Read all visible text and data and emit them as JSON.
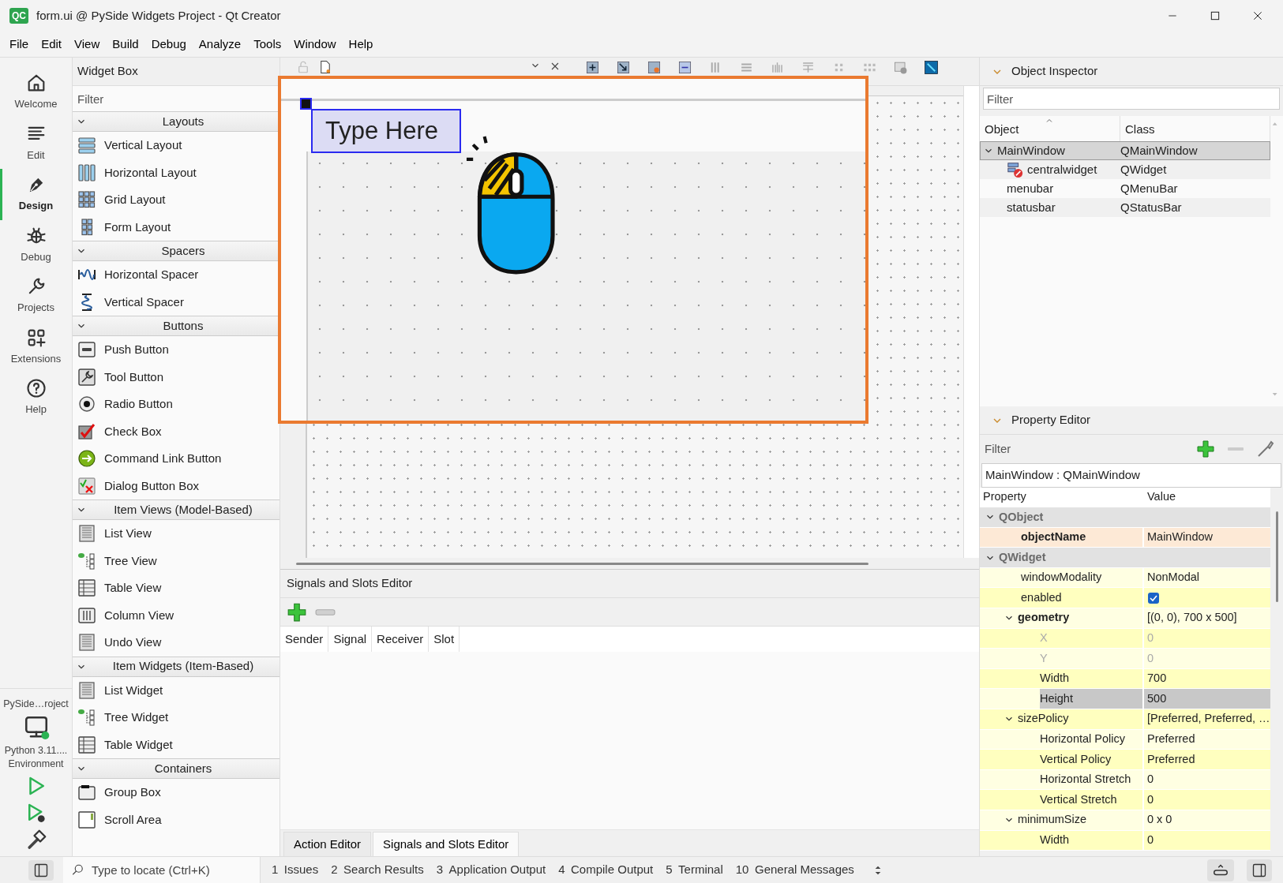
{
  "window": {
    "icon_text": "QC",
    "title": "form.ui @ PySide Widgets Project - Qt Creator"
  },
  "menu": [
    "File",
    "Edit",
    "View",
    "Build",
    "Debug",
    "Analyze",
    "Tools",
    "Window",
    "Help"
  ],
  "modes": [
    {
      "label": "Welcome",
      "kind": "home",
      "selected": false
    },
    {
      "label": "Edit",
      "kind": "edit",
      "selected": false
    },
    {
      "label": "Design",
      "kind": "design",
      "selected": true
    },
    {
      "label": "Debug",
      "kind": "debug",
      "selected": false
    },
    {
      "label": "Projects",
      "kind": "projects",
      "selected": false
    },
    {
      "label": "Extensions",
      "kind": "extensions",
      "selected": false
    },
    {
      "label": "Help",
      "kind": "help",
      "selected": false
    }
  ],
  "kit": {
    "project": "PySide…roject",
    "lines": [
      "Python 3.11....",
      "Environment"
    ]
  },
  "widget_box": {
    "title": "Widget Box",
    "filter_placeholder": "Filter",
    "categories": [
      {
        "name": "Layouts",
        "expanded": true,
        "items": [
          {
            "label": "Vertical Layout",
            "kind": "vlayout"
          },
          {
            "label": "Horizontal Layout",
            "kind": "hlayout"
          },
          {
            "label": "Grid Layout",
            "kind": "grid"
          },
          {
            "label": "Form Layout",
            "kind": "form"
          }
        ]
      },
      {
        "name": "Spacers",
        "expanded": true,
        "items": [
          {
            "label": "Horizontal Spacer",
            "kind": "hspacer"
          },
          {
            "label": "Vertical Spacer",
            "kind": "vspacer"
          }
        ]
      },
      {
        "name": "Buttons",
        "expanded": true,
        "items": [
          {
            "label": "Push Button",
            "kind": "push"
          },
          {
            "label": "Tool Button",
            "kind": "tool"
          },
          {
            "label": "Radio Button",
            "kind": "radio"
          },
          {
            "label": "Check Box",
            "kind": "check"
          },
          {
            "label": "Command Link Button",
            "kind": "link"
          },
          {
            "label": "Dialog Button Box",
            "kind": "dialog"
          }
        ]
      },
      {
        "name": "Item Views (Model-Based)",
        "expanded": true,
        "items": [
          {
            "label": "List View",
            "kind": "list"
          },
          {
            "label": "Tree View",
            "kind": "tree"
          },
          {
            "label": "Table View",
            "kind": "table"
          },
          {
            "label": "Column View",
            "kind": "columns"
          },
          {
            "label": "Undo View",
            "kind": "list"
          }
        ]
      },
      {
        "name": "Item Widgets (Item-Based)",
        "expanded": true,
        "items": [
          {
            "label": "List Widget",
            "kind": "list"
          },
          {
            "label": "Tree Widget",
            "kind": "tree"
          },
          {
            "label": "Table Widget",
            "kind": "table"
          }
        ]
      },
      {
        "name": "Containers",
        "expanded": true,
        "items": [
          {
            "label": "Group Box",
            "kind": "group"
          },
          {
            "label": "Scroll Area",
            "kind": "scroll"
          }
        ]
      }
    ]
  },
  "form": {
    "menu_placeholder": "Type Here"
  },
  "signals_editor": {
    "title": "Signals and Slots Editor",
    "columns": [
      "Sender",
      "Signal",
      "Receiver",
      "Slot"
    ],
    "tabs": [
      {
        "label": "Action Editor",
        "selected": false
      },
      {
        "label": "Signals and Slots Editor",
        "selected": true
      }
    ]
  },
  "object_inspector": {
    "title": "Object Inspector",
    "filter_placeholder": "Filter",
    "columns": [
      "Object",
      "Class"
    ],
    "rows": [
      {
        "object": "MainWindow",
        "class": "QMainWindow",
        "selected": true,
        "expanded": true,
        "children": [
          {
            "object": "centralwidget",
            "class": "QWidget",
            "selected": false,
            "kind": "broken-layout"
          },
          {
            "object": "menubar",
            "class": "QMenuBar",
            "selected": false
          },
          {
            "object": "statusbar",
            "class": "QStatusBar",
            "selected": false
          }
        ]
      }
    ]
  },
  "property_editor": {
    "title": "Property Editor",
    "filter_placeholder": "Filter",
    "object_label": "MainWindow : QMainWindow",
    "columns": [
      "Property",
      "Value"
    ],
    "groups": [
      {
        "name": "QObject",
        "expanded": true,
        "color": "#fde9d6",
        "properties": [
          {
            "name": "objectName",
            "value": "MainWindow",
            "kind": "text",
            "modified": true,
            "disabled": false,
            "selected": false
          }
        ]
      },
      {
        "name": "QWidget",
        "expanded": true,
        "color": "#ffffbf",
        "properties": [
          {
            "name": "windowModality",
            "value": "NonModal",
            "kind": "text",
            "modified": false,
            "disabled": false,
            "selected": false
          },
          {
            "name": "enabled",
            "checked": true,
            "kind": "check",
            "modified": false,
            "disabled": false,
            "selected": false
          },
          {
            "name": "geometry",
            "value": "[(0, 0), 700 x 500]",
            "kind": "text",
            "modified": true,
            "disabled": false,
            "selected": false,
            "expanded": true,
            "children": [
              {
                "name": "X",
                "value": "0",
                "kind": "text",
                "modified": false,
                "disabled": true,
                "selected": false
              },
              {
                "name": "Y",
                "value": "0",
                "kind": "text",
                "modified": false,
                "disabled": true,
                "selected": false
              },
              {
                "name": "Width",
                "value": "700",
                "kind": "text",
                "modified": false,
                "disabled": false,
                "selected": false
              },
              {
                "name": "Height",
                "value": "500",
                "kind": "text",
                "modified": false,
                "disabled": false,
                "selected": true
              }
            ]
          },
          {
            "name": "sizePolicy",
            "value": "[Preferred, Preferred, …",
            "kind": "text",
            "modified": false,
            "disabled": false,
            "selected": false,
            "expanded": true,
            "children": [
              {
                "name": "Horizontal Policy",
                "value": "Preferred",
                "kind": "text",
                "modified": false,
                "disabled": false,
                "selected": false
              },
              {
                "name": "Vertical Policy",
                "value": "Preferred",
                "kind": "text",
                "modified": false,
                "disabled": false,
                "selected": false
              },
              {
                "name": "Horizontal Stretch",
                "value": "0",
                "kind": "text",
                "modified": false,
                "disabled": false,
                "selected": false
              },
              {
                "name": "Vertical Stretch",
                "value": "0",
                "kind": "text",
                "modified": false,
                "disabled": false,
                "selected": false
              }
            ]
          },
          {
            "name": "minimumSize",
            "value": "0 x 0",
            "kind": "text",
            "modified": false,
            "disabled": false,
            "selected": false,
            "expanded": true,
            "children": [
              {
                "name": "Width",
                "value": "0",
                "kind": "text",
                "modified": false,
                "disabled": false,
                "selected": false
              }
            ]
          }
        ]
      }
    ]
  },
  "status_bar": {
    "locator_placeholder": "Type to locate (Ctrl+K)",
    "panes": [
      {
        "number": "1",
        "label": "Issues"
      },
      {
        "number": "2",
        "label": "Search Results"
      },
      {
        "number": "3",
        "label": "Application Output"
      },
      {
        "number": "4",
        "label": "Compile Output"
      },
      {
        "number": "5",
        "label": "Terminal"
      },
      {
        "number": "10",
        "label": "General Messages"
      }
    ]
  }
}
